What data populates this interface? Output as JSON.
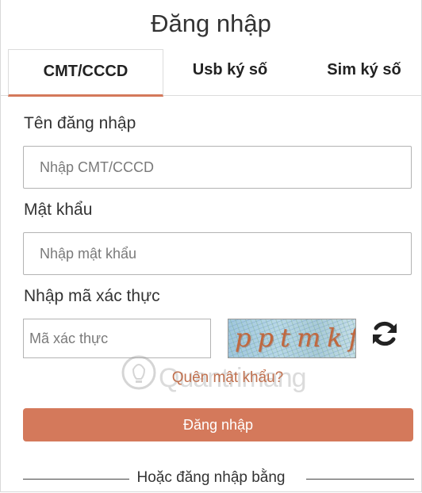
{
  "page": {
    "title": "Đăng nhập"
  },
  "tabs": [
    {
      "label": "CMT/CCCD",
      "active": true
    },
    {
      "label": "Usb ký số",
      "active": false
    },
    {
      "label": "Sim ký số",
      "active": false
    }
  ],
  "form": {
    "username_label": "Tên đăng nhập",
    "username_placeholder": "Nhập CMT/CCCD",
    "password_label": "Mật khẩu",
    "password_placeholder": "Nhập mật khẩu",
    "captcha_label": "Nhập mã xác thực",
    "captcha_placeholder": "Mã xác thực",
    "captcha_text": "pptmkf",
    "forgot_label": "Quên mật khẩu?",
    "submit_label": "Đăng nhập",
    "alt_login_label": "Hoặc đăng nhập bằng"
  },
  "watermark": {
    "text": "Quantrimang"
  },
  "colors": {
    "accent": "#d4795b",
    "link": "#c1714f",
    "border": "#b3b3b3"
  },
  "icons": {
    "refresh": "refresh-icon",
    "watermark": "lightbulb-icon"
  }
}
